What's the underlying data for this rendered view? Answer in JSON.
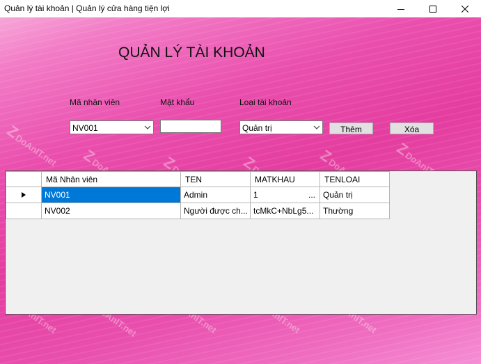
{
  "window": {
    "title": "Quản lý tài khoản | Quản lý cửa hàng tiện lợi"
  },
  "form": {
    "heading": "QUẢN LÝ TÀI KHOẢN",
    "employee_id_label": "Mã nhân viên",
    "password_label": "Mật khẩu",
    "account_type_label": "Loại tài khoản",
    "employee_id_value": "NV001",
    "password_value": "",
    "account_type_value": "Quản trị",
    "add_button": "Thêm",
    "delete_button": "Xóa"
  },
  "grid": {
    "columns": [
      "Mã Nhân viên",
      "TEN",
      "MATKHAU",
      "TENLOAI"
    ],
    "rows": [
      [
        "NV001",
        "Admin",
        "1",
        "Quản trị"
      ],
      [
        "NV002",
        "Người được ch...",
        "tcMkC+NbLg5...",
        "Thường"
      ]
    ],
    "selected_row": 0,
    "ellipsis": "..."
  },
  "watermark": {
    "text": "DoAnIT.net"
  },
  "colors": {
    "selection": "#0078d7",
    "background_pink": "#e43d9f"
  }
}
